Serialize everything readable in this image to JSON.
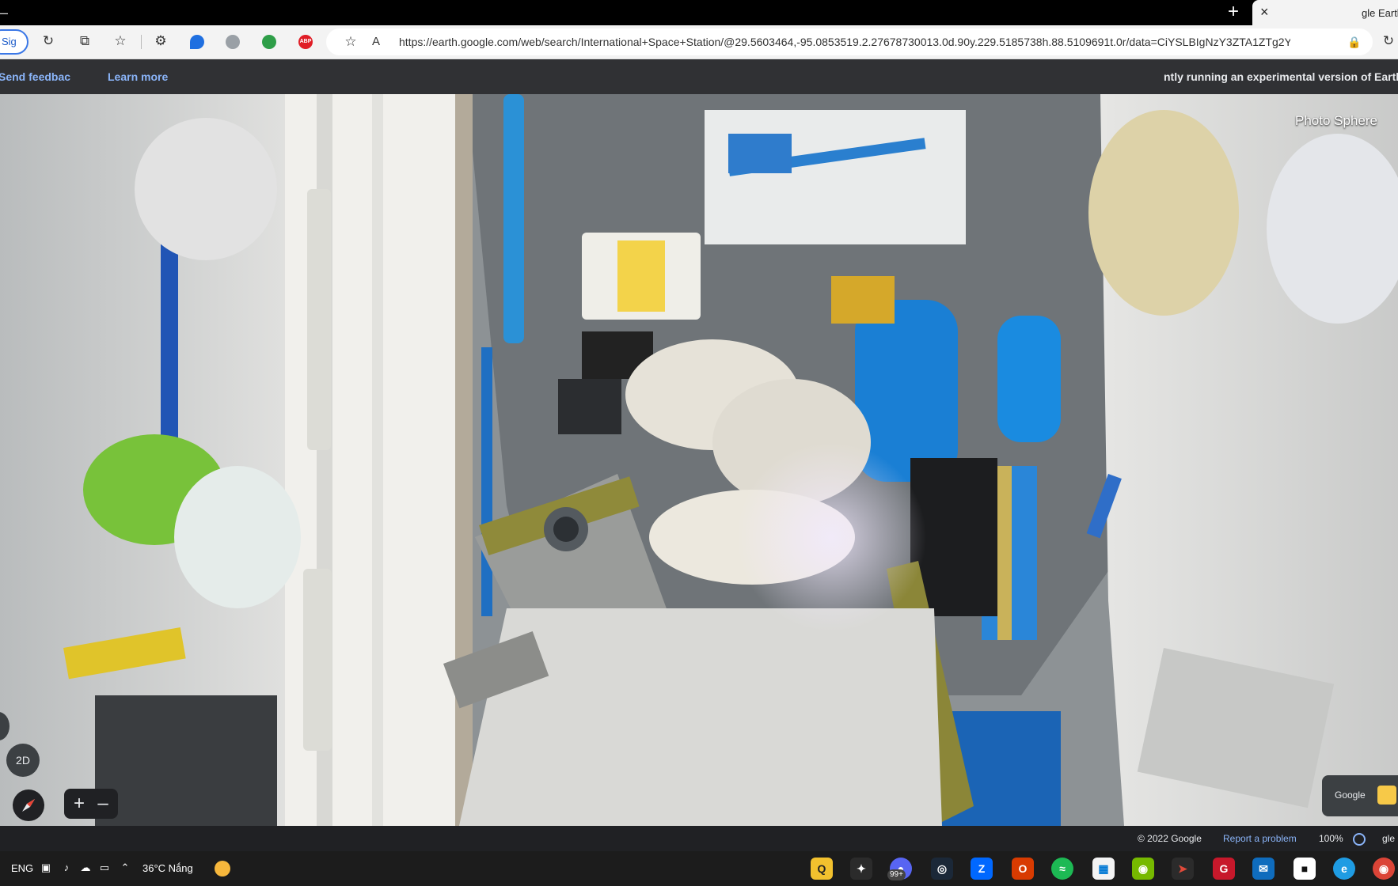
{
  "window": {
    "tab_title": "gle Earth",
    "close_glyph": "×",
    "new_tab_glyph": "+",
    "minimize_glyph": "–"
  },
  "toolbar": {
    "signin_label": "Sig",
    "url": "https://earth.google.com/web/search/International+Space+Station/@29.5603464,-95.0853519.2.27678730013.0d.90y.229.5185738h.88.5109691t.0r/data=CiYSLBIgNzY3ZTA1ZTg2Y...",
    "reader_glyph": "A",
    "icons": [
      "refresh-icon",
      "lock-icon",
      "reader-view-icon",
      "favorite-add-icon",
      "extensions-icon",
      "collections-icon",
      "favorites-icon",
      "refresh-page-icon"
    ]
  },
  "banner": {
    "text": "ntly running an experimental version of Earth.",
    "learn_more": "Learn more",
    "send_feedback": "Send feedbac"
  },
  "viewer": {
    "photo_sphere_label": "Photo Sphere",
    "btn_2d": "2D",
    "zoom_in": "+",
    "zoom_out": "–",
    "attribution_label": "Google"
  },
  "statusbar": {
    "google": "gle",
    "zoom_pct": "100%",
    "report": "Report a problem",
    "copyright": "© 2022 Google"
  },
  "taskbar": {
    "language": "ENG",
    "weather": "36°C Nắng",
    "apps": [
      "chrome",
      "edge",
      "roblox",
      "mail",
      "garena",
      "arrow-app",
      "nvidia",
      "store",
      "spotify",
      "office",
      "zalo",
      "steam",
      "discord",
      "feather-app",
      "kakao"
    ],
    "zalo_badge": "99+"
  },
  "colors": {
    "accent_blue": "#8ab4f8",
    "banner_bg": "#303134",
    "taskbar_bg": "#1c1c1c",
    "abp_red": "#e01d26"
  }
}
